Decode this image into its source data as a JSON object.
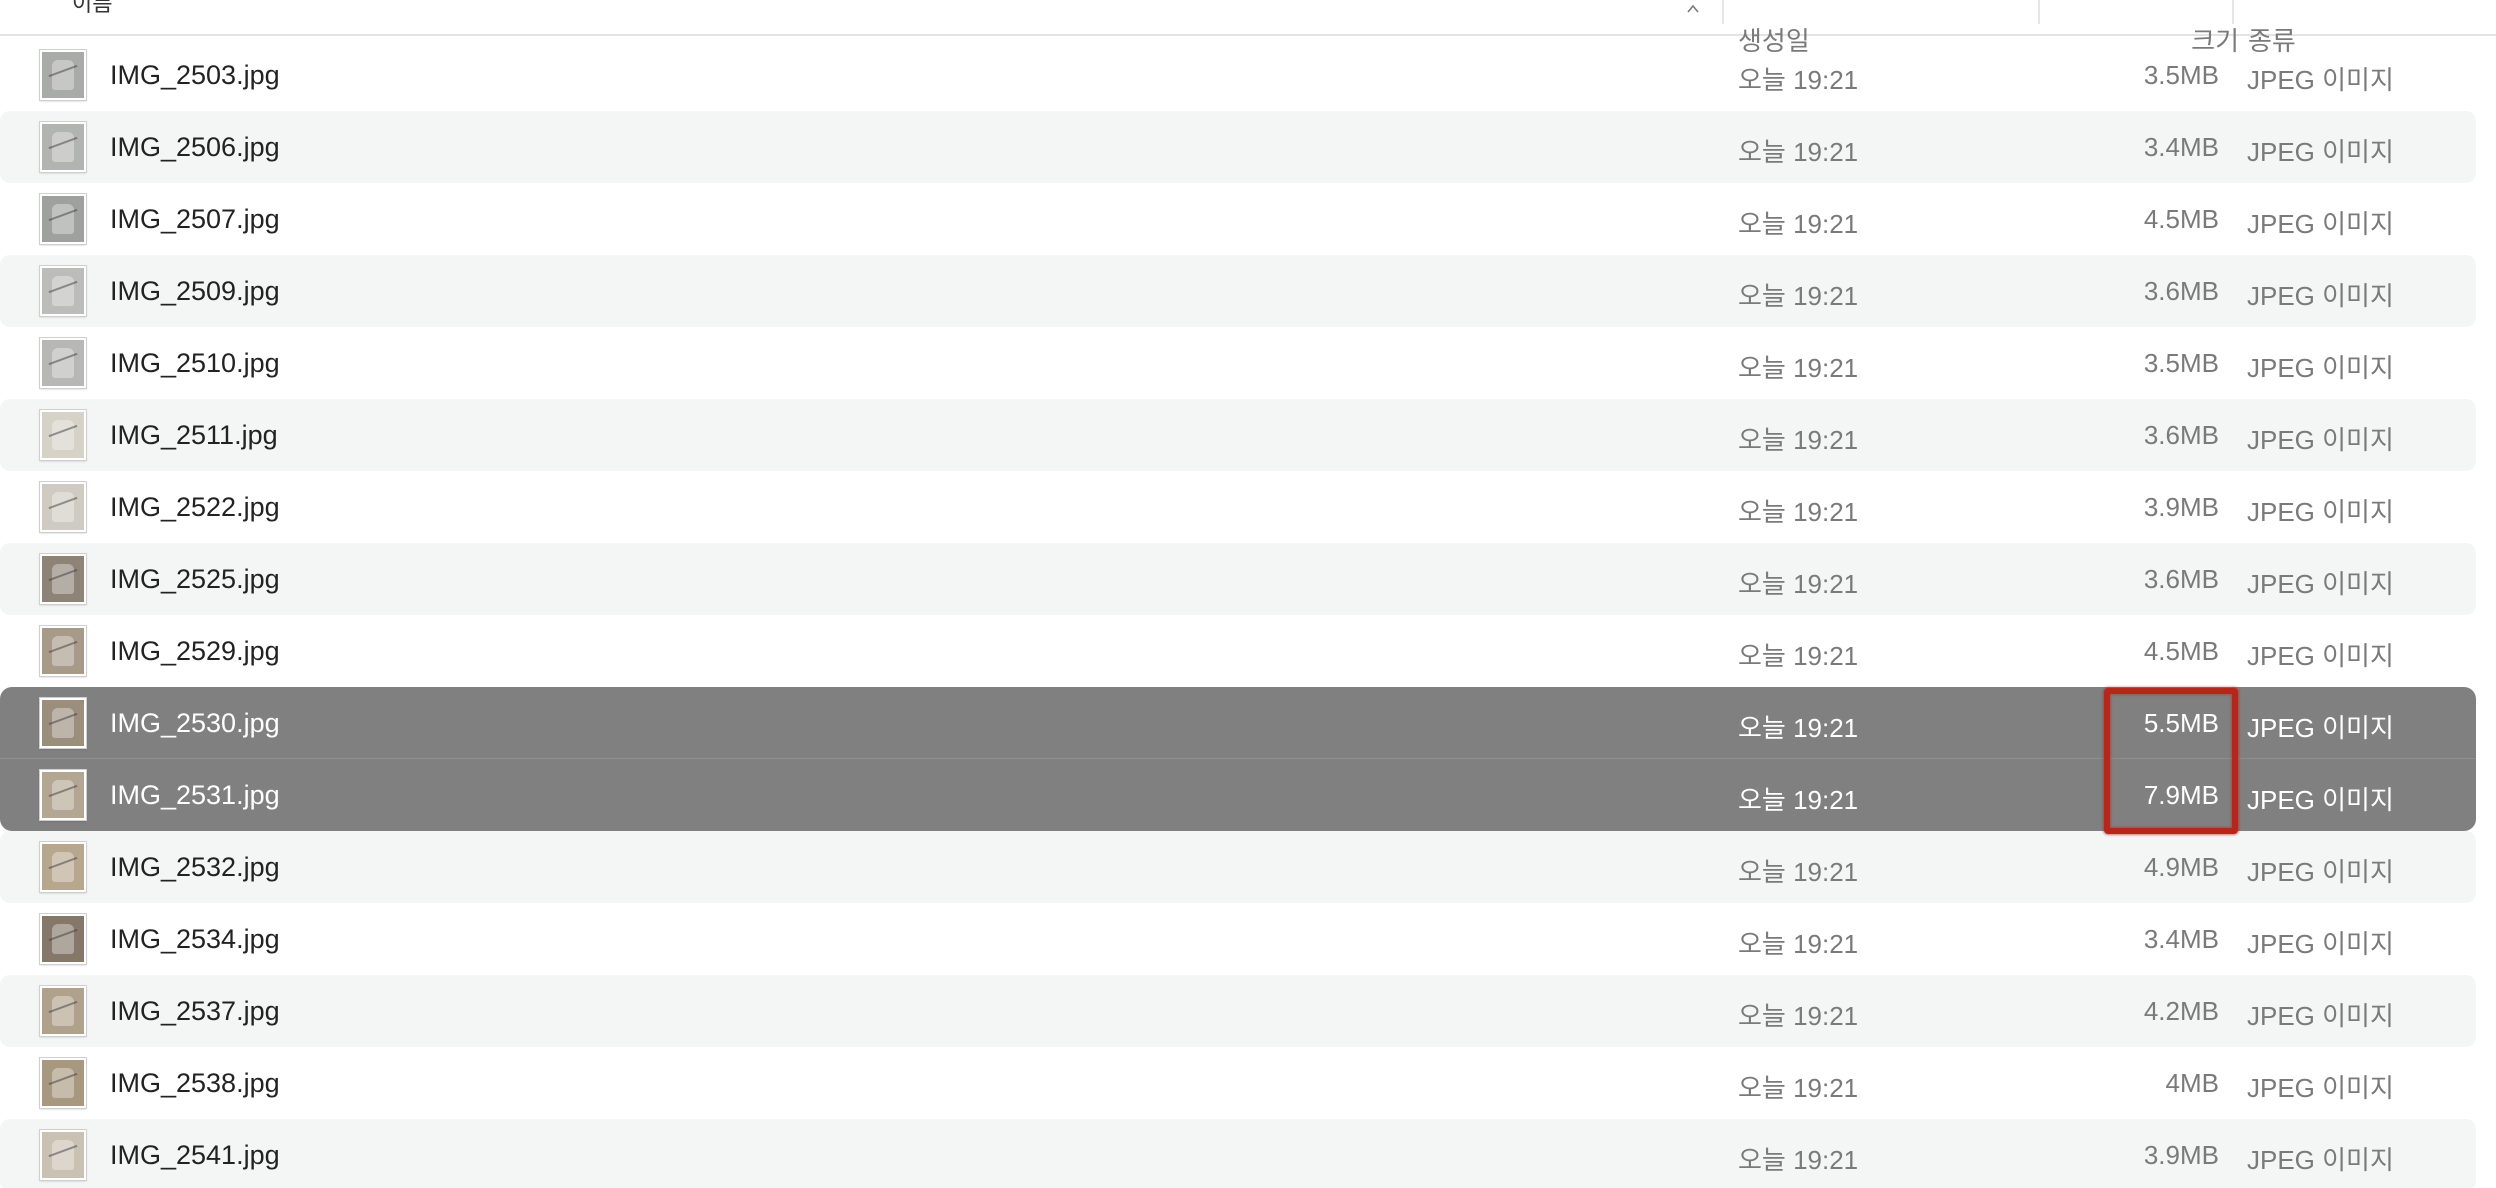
{
  "header": {
    "name_label": "이름",
    "created_label": "생성일",
    "size_label": "크기",
    "kind_label": "종류"
  },
  "colors": {
    "selection": "#808080",
    "alt_row": "#f4f5f5",
    "annotation": "#b5261b"
  },
  "files": [
    {
      "name": "IMG_2503.jpg",
      "created": "오늘 19:21",
      "size": "3.5MB",
      "kind": "JPEG 이미지",
      "selected": false,
      "thumb_color": "#a9aba8"
    },
    {
      "name": "IMG_2506.jpg",
      "created": "오늘 19:21",
      "size": "3.4MB",
      "kind": "JPEG 이미지",
      "selected": false,
      "thumb_color": "#b2b4b1"
    },
    {
      "name": "IMG_2507.jpg",
      "created": "오늘 19:21",
      "size": "4.5MB",
      "kind": "JPEG 이미지",
      "selected": false,
      "thumb_color": "#9fa19e"
    },
    {
      "name": "IMG_2509.jpg",
      "created": "오늘 19:21",
      "size": "3.6MB",
      "kind": "JPEG 이미지",
      "selected": false,
      "thumb_color": "#bcbdba"
    },
    {
      "name": "IMG_2510.jpg",
      "created": "오늘 19:21",
      "size": "3.5MB",
      "kind": "JPEG 이미지",
      "selected": false,
      "thumb_color": "#b7b8b5"
    },
    {
      "name": "IMG_2511.jpg",
      "created": "오늘 19:21",
      "size": "3.6MB",
      "kind": "JPEG 이미지",
      "selected": false,
      "thumb_color": "#d6d2c8"
    },
    {
      "name": "IMG_2522.jpg",
      "created": "오늘 19:21",
      "size": "3.9MB",
      "kind": "JPEG 이미지",
      "selected": false,
      "thumb_color": "#cfcbc2"
    },
    {
      "name": "IMG_2525.jpg",
      "created": "오늘 19:21",
      "size": "3.6MB",
      "kind": "JPEG 이미지",
      "selected": false,
      "thumb_color": "#8e8377"
    },
    {
      "name": "IMG_2529.jpg",
      "created": "오늘 19:21",
      "size": "4.5MB",
      "kind": "JPEG 이미지",
      "selected": false,
      "thumb_color": "#a89a89"
    },
    {
      "name": "IMG_2530.jpg",
      "created": "오늘 19:21",
      "size": "5.5MB",
      "kind": "JPEG 이미지",
      "selected": true,
      "thumb_color": "#9c8e7d"
    },
    {
      "name": "IMG_2531.jpg",
      "created": "오늘 19:21",
      "size": "7.9MB",
      "kind": "JPEG 이미지",
      "selected": true,
      "thumb_color": "#b3a693"
    },
    {
      "name": "IMG_2532.jpg",
      "created": "오늘 19:21",
      "size": "4.9MB",
      "kind": "JPEG 이미지",
      "selected": false,
      "thumb_color": "#b8a78f"
    },
    {
      "name": "IMG_2534.jpg",
      "created": "오늘 19:21",
      "size": "3.4MB",
      "kind": "JPEG 이미지",
      "selected": false,
      "thumb_color": "#857869"
    },
    {
      "name": "IMG_2537.jpg",
      "created": "오늘 19:21",
      "size": "4.2MB",
      "kind": "JPEG 이미지",
      "selected": false,
      "thumb_color": "#b0a18d"
    },
    {
      "name": "IMG_2538.jpg",
      "created": "오늘 19:21",
      "size": "4MB",
      "kind": "JPEG 이미지",
      "selected": false,
      "thumb_color": "#a7987f"
    },
    {
      "name": "IMG_2541.jpg",
      "created": "오늘 19:21",
      "size": "3.9MB",
      "kind": "JPEG 이미지",
      "selected": false,
      "thumb_color": "#c9c1b2"
    }
  ]
}
